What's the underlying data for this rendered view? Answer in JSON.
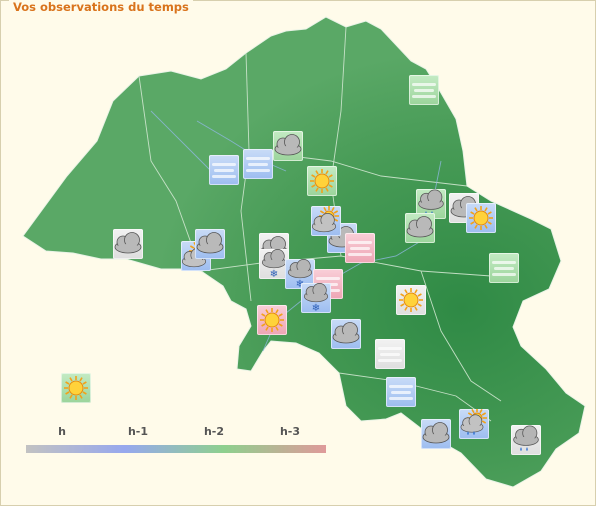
{
  "title": "Vos observations du temps",
  "legend": {
    "labels": [
      "h",
      "h-1",
      "h-2",
      "h-3"
    ],
    "colors": [
      "#c2c2c2",
      "#97a8ee",
      "#8ed08e",
      "#df9a9a"
    ]
  },
  "map": {
    "country": "Belgium",
    "land_color": "#4e9e5a",
    "sea_color": "#fffbea"
  },
  "observations": [
    {
      "icon": "fog-icon",
      "age": "h-2"
    },
    {
      "icon": "fog-icon",
      "age": "h-1"
    },
    {
      "icon": "cloudy-icon",
      "age": "h-2"
    },
    {
      "icon": "fog-icon",
      "age": "h-1"
    },
    {
      "icon": "sunny-icon",
      "age": "h-2"
    },
    {
      "icon": "cloud-rain-icon",
      "age": "h-2"
    },
    {
      "icon": "cloudy-icon",
      "age": "h"
    },
    {
      "icon": "sunny-icon",
      "age": "h-1"
    },
    {
      "icon": "cloudy-icon",
      "age": "h-2"
    },
    {
      "icon": "cloudy-icon",
      "age": "h"
    },
    {
      "icon": "cloudy-icon",
      "age": "h"
    },
    {
      "icon": "sun-cloud-icon",
      "age": "h-1"
    },
    {
      "icon": "cloudy-icon",
      "age": "h-1"
    },
    {
      "icon": "cloud-snow-icon",
      "age": "h"
    },
    {
      "icon": "cloud-snow-icon",
      "age": "h-1"
    },
    {
      "icon": "cloudy-icon",
      "age": "h-1"
    },
    {
      "icon": "sun-cloud-icon",
      "age": "h-1"
    },
    {
      "icon": "fog-icon",
      "age": "h-3"
    },
    {
      "icon": "fog-icon",
      "age": "h-3"
    },
    {
      "icon": "cloud-snow-icon",
      "age": "h-1"
    },
    {
      "icon": "fog-icon",
      "age": "h-2"
    },
    {
      "icon": "sunny-icon",
      "age": "h"
    },
    {
      "icon": "sunny-icon",
      "age": "h-3"
    },
    {
      "icon": "cloudy-icon",
      "age": "h-1"
    },
    {
      "icon": "fog-icon",
      "age": "h"
    },
    {
      "icon": "sunny-icon",
      "age": "h-2"
    },
    {
      "icon": "fog-icon",
      "age": "h-1"
    },
    {
      "icon": "cloudy-icon",
      "age": "h-1"
    },
    {
      "icon": "sun-cloud-rain-icon",
      "age": "h-1"
    },
    {
      "icon": "cloud-rain-icon",
      "age": "h"
    }
  ]
}
